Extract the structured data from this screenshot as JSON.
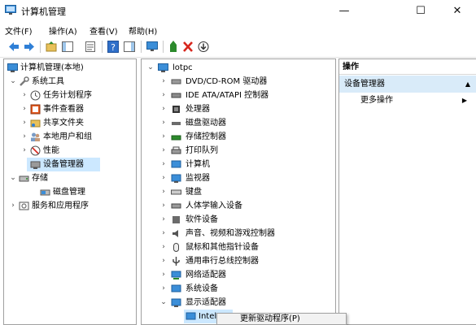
{
  "window": {
    "title": "计算机管理",
    "minimize": "—",
    "maximize": "☐",
    "close": "✕"
  },
  "menu": {
    "file": "文件(F)",
    "action": "操作(A)",
    "view": "查看(V)",
    "help": "帮助(H)"
  },
  "colors": {
    "accent_blue": "#0078d7",
    "selection": "#cce8ff",
    "action_section": "#d9ebf9",
    "close_red": "#d7261d",
    "desktop": "#1c6fd1"
  },
  "left_tree": {
    "root": "计算机管理(本地)",
    "system_tools": "系统工具",
    "task_scheduler": "任务计划程序",
    "event_viewer": "事件查看器",
    "shared_folders": "共享文件夹",
    "local_users": "本地用户和组",
    "performance": "性能",
    "device_manager": "设备管理器",
    "storage": "存储",
    "disk_management": "磁盘管理",
    "services_apps": "服务和应用程序"
  },
  "device_tree": {
    "root": "lotpc",
    "items": [
      "DVD/CD-ROM 驱动器",
      "IDE ATA/ATAPI 控制器",
      "处理器",
      "磁盘驱动器",
      "存储控制器",
      "打印队列",
      "计算机",
      "监视器",
      "键盘",
      "人体学输入设备",
      "软件设备",
      "声音、视频和游戏控制器",
      "鼠标和其他指针设备",
      "通用串行总线控制器",
      "网络适配器",
      "系统设备",
      "显示适配器"
    ],
    "display_child": "Intel"
  },
  "actions": {
    "header": "操作",
    "section": "设备管理器",
    "more": "更多操作"
  },
  "context_menu": {
    "update_driver": "更新驱动程序(P)"
  }
}
